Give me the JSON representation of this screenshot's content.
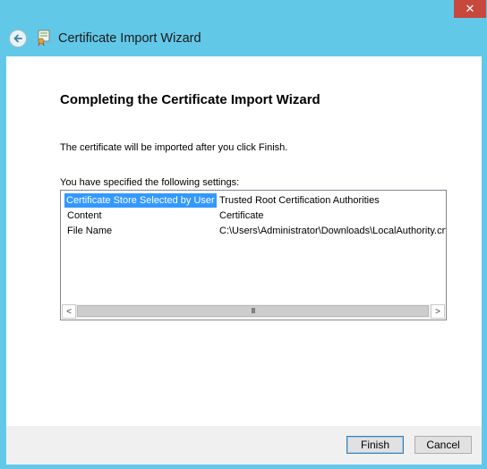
{
  "window": {
    "title": "Certificate Import Wizard",
    "close_glyph": "✕"
  },
  "page": {
    "heading": "Completing the Certificate Import Wizard",
    "info": "The certificate will be imported after you click Finish.",
    "settings_label": "You have specified the following settings:"
  },
  "settings": [
    {
      "name": "Certificate Store Selected by User",
      "value": "Trusted Root Certification Authorities",
      "selected": true
    },
    {
      "name": "Content",
      "value": "Certificate",
      "selected": false
    },
    {
      "name": "File Name",
      "value": "C:\\Users\\Administrator\\Downloads\\LocalAuthority.crt",
      "selected": false
    }
  ],
  "scrollbar": {
    "left_arrow": "<",
    "right_arrow": ">",
    "thumb_grip": "III"
  },
  "buttons": {
    "finish": "Finish",
    "cancel": "Cancel"
  },
  "colors": {
    "window_frame": "#62c8e8",
    "selection": "#3399ff",
    "close_button": "#c7483c"
  },
  "icons": {
    "back": "back-arrow-icon",
    "title": "certificate-icon",
    "close": "close-icon"
  }
}
